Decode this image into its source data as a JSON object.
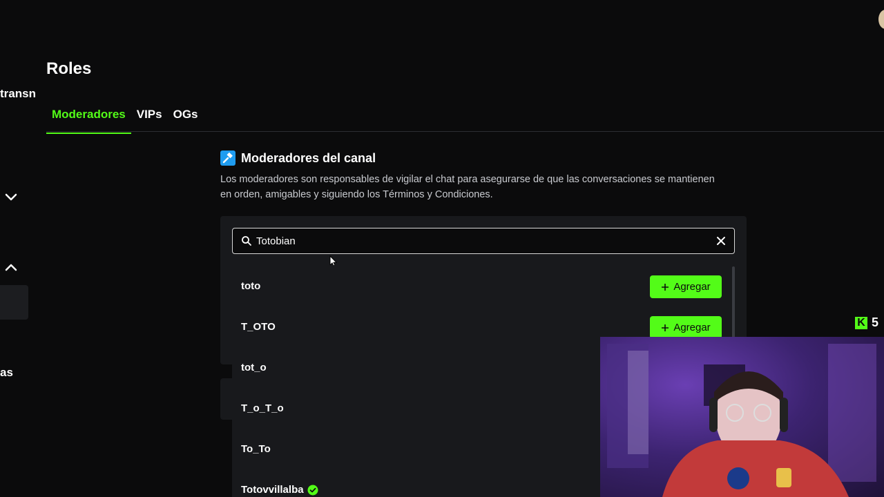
{
  "sidebar": {
    "fragment_top": "transn",
    "fragment_bottom": "as"
  },
  "page": {
    "title": "Roles",
    "tabs": [
      {
        "label": "Moderadores",
        "active": true
      },
      {
        "label": "VIPs",
        "active": false
      },
      {
        "label": "OGs",
        "active": false
      }
    ]
  },
  "section": {
    "title": "Moderadores del canal",
    "description": "Los moderadores son responsables de vigilar el chat para asegurarse de que las conversaciones se mantienen en orden, amigables y siguiendo los Términos y Condiciones."
  },
  "search": {
    "value": "Totobian"
  },
  "results": [
    {
      "name": "toto",
      "add_label": "Agregar"
    },
    {
      "name": "T_OTO",
      "add_label": "Agregar"
    },
    {
      "name": "tot_o"
    },
    {
      "name": "T_o_T_o"
    },
    {
      "name": "To_To"
    },
    {
      "name": "Totovvillalba",
      "verified": true
    }
  ],
  "overlay": {
    "kick_count": "5"
  },
  "colors": {
    "accent": "#53fc18",
    "background": "#0b0b0c",
    "panel": "#18191c",
    "section_icon": "#1f9cf0"
  }
}
